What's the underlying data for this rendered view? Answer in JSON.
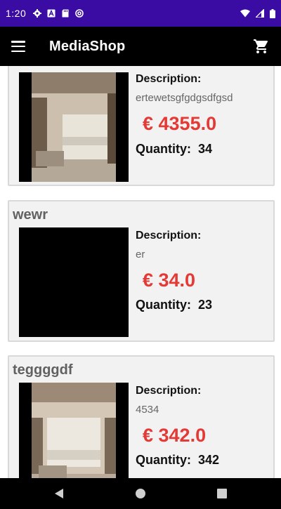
{
  "status_bar": {
    "time": "1:20",
    "left_icons": [
      "gear-icon",
      "font-icon",
      "sd-card-icon",
      "at-sign-icon"
    ],
    "right_icons": [
      "wifi-icon",
      "cell-signal-icon",
      "battery-icon"
    ]
  },
  "app_bar": {
    "title": "MediaShop",
    "menu_icon": "menu-icon",
    "cart_icon": "shopping-cart-icon"
  },
  "labels": {
    "description": "Description:",
    "quantity": "Quantity:"
  },
  "products": [
    {
      "name": "",
      "description": "ertewetsgfgdgsdfgsd",
      "price": "€ 4355.0",
      "quantity": "34",
      "image": "room-photo"
    },
    {
      "name": "wewr",
      "description": "er",
      "price": "€ 34.0",
      "quantity": "23",
      "image": "black"
    },
    {
      "name": "teggggdf",
      "description": "4534",
      "price": "€ 342.0",
      "quantity": "342",
      "image": "room-photo"
    }
  ],
  "nav_bar": {
    "buttons": [
      "back-icon",
      "home-icon",
      "recents-icon"
    ]
  },
  "colors": {
    "status_bar": "#3a0ca3",
    "app_bar": "#000000",
    "price": "#e53935",
    "card_bg": "#f2f2f2"
  }
}
